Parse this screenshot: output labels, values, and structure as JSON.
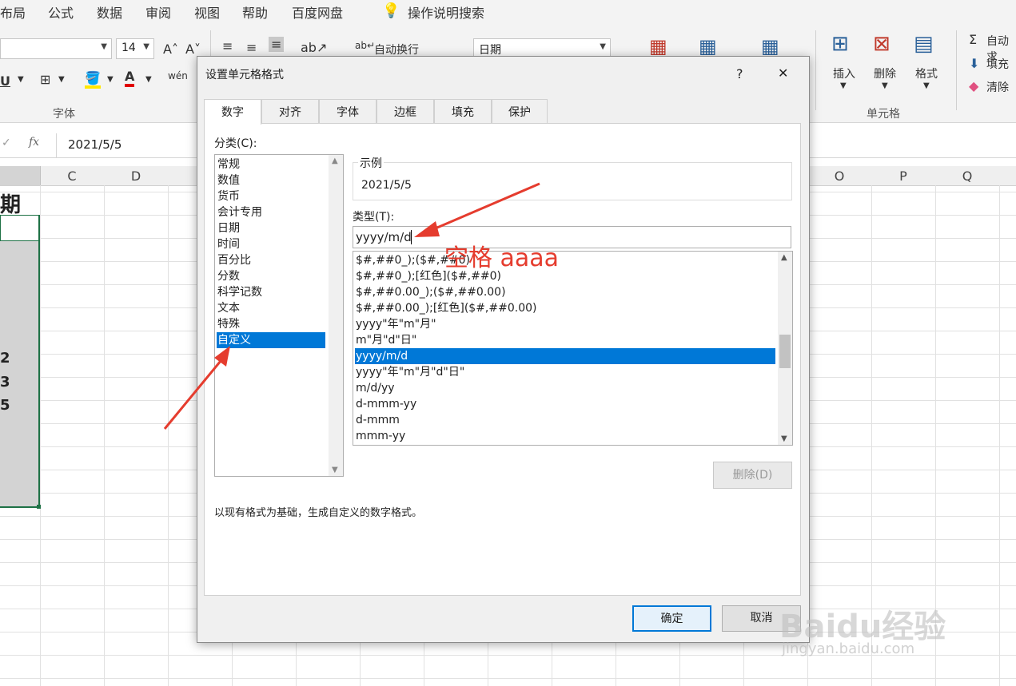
{
  "ribbon_tabs": [
    "布局",
    "公式",
    "数据",
    "审阅",
    "视图",
    "帮助",
    "百度网盘",
    "操作说明搜索"
  ],
  "ribbon": {
    "font_size": "14",
    "number_format": "日期",
    "wrap_text": "自动换行",
    "font_group_label": "字体",
    "cells_group_label": "单元格",
    "insert_label": "插入",
    "delete_label": "删除",
    "format_label": "格式",
    "autosum_label": "自动求",
    "fill_label": "填充",
    "clear_label": "清除"
  },
  "formula_bar": {
    "fx": "fx",
    "value": "2021/5/5"
  },
  "columns": [
    "C",
    "D",
    "O",
    "P",
    "Q"
  ],
  "sheet_cells": {
    "header_char": "期",
    "row1": "2",
    "row2": "3",
    "row3": "5"
  },
  "dialog": {
    "title": "设置单元格格式",
    "help": "?",
    "close": "✕",
    "tabs": [
      "数字",
      "对齐",
      "字体",
      "边框",
      "填充",
      "保护"
    ],
    "category_label": "分类(C):",
    "categories": [
      "常规",
      "数值",
      "货币",
      "会计专用",
      "日期",
      "时间",
      "百分比",
      "分数",
      "科学记数",
      "文本",
      "特殊",
      "自定义"
    ],
    "selected_category": "自定义",
    "sample_label": "示例",
    "sample_value": "2021/5/5",
    "type_label": "类型(T):",
    "type_value": "yyyy/m/d",
    "formats": [
      "$#,##0_);($#,##0)",
      "$#,##0_);[红色]($#,##0)",
      "$#,##0.00_);($#,##0.00)",
      "$#,##0.00_);[红色]($#,##0.00)",
      "yyyy\"年\"m\"月\"",
      "m\"月\"d\"日\"",
      "yyyy/m/d",
      "yyyy\"年\"m\"月\"d\"日\"",
      "m/d/yy",
      "d-mmm-yy",
      "d-mmm",
      "mmm-yy"
    ],
    "selected_format": "yyyy/m/d",
    "delete_button": "删除(D)",
    "description": "以现有格式为基础，生成自定义的数字格式。",
    "ok": "确定",
    "cancel": "取消"
  },
  "annotation": {
    "text": "空格 aaaa",
    "color": "#e53c2e"
  },
  "watermark": {
    "brand": "Baidu经验",
    "url": "jingyan.baidu.com"
  }
}
